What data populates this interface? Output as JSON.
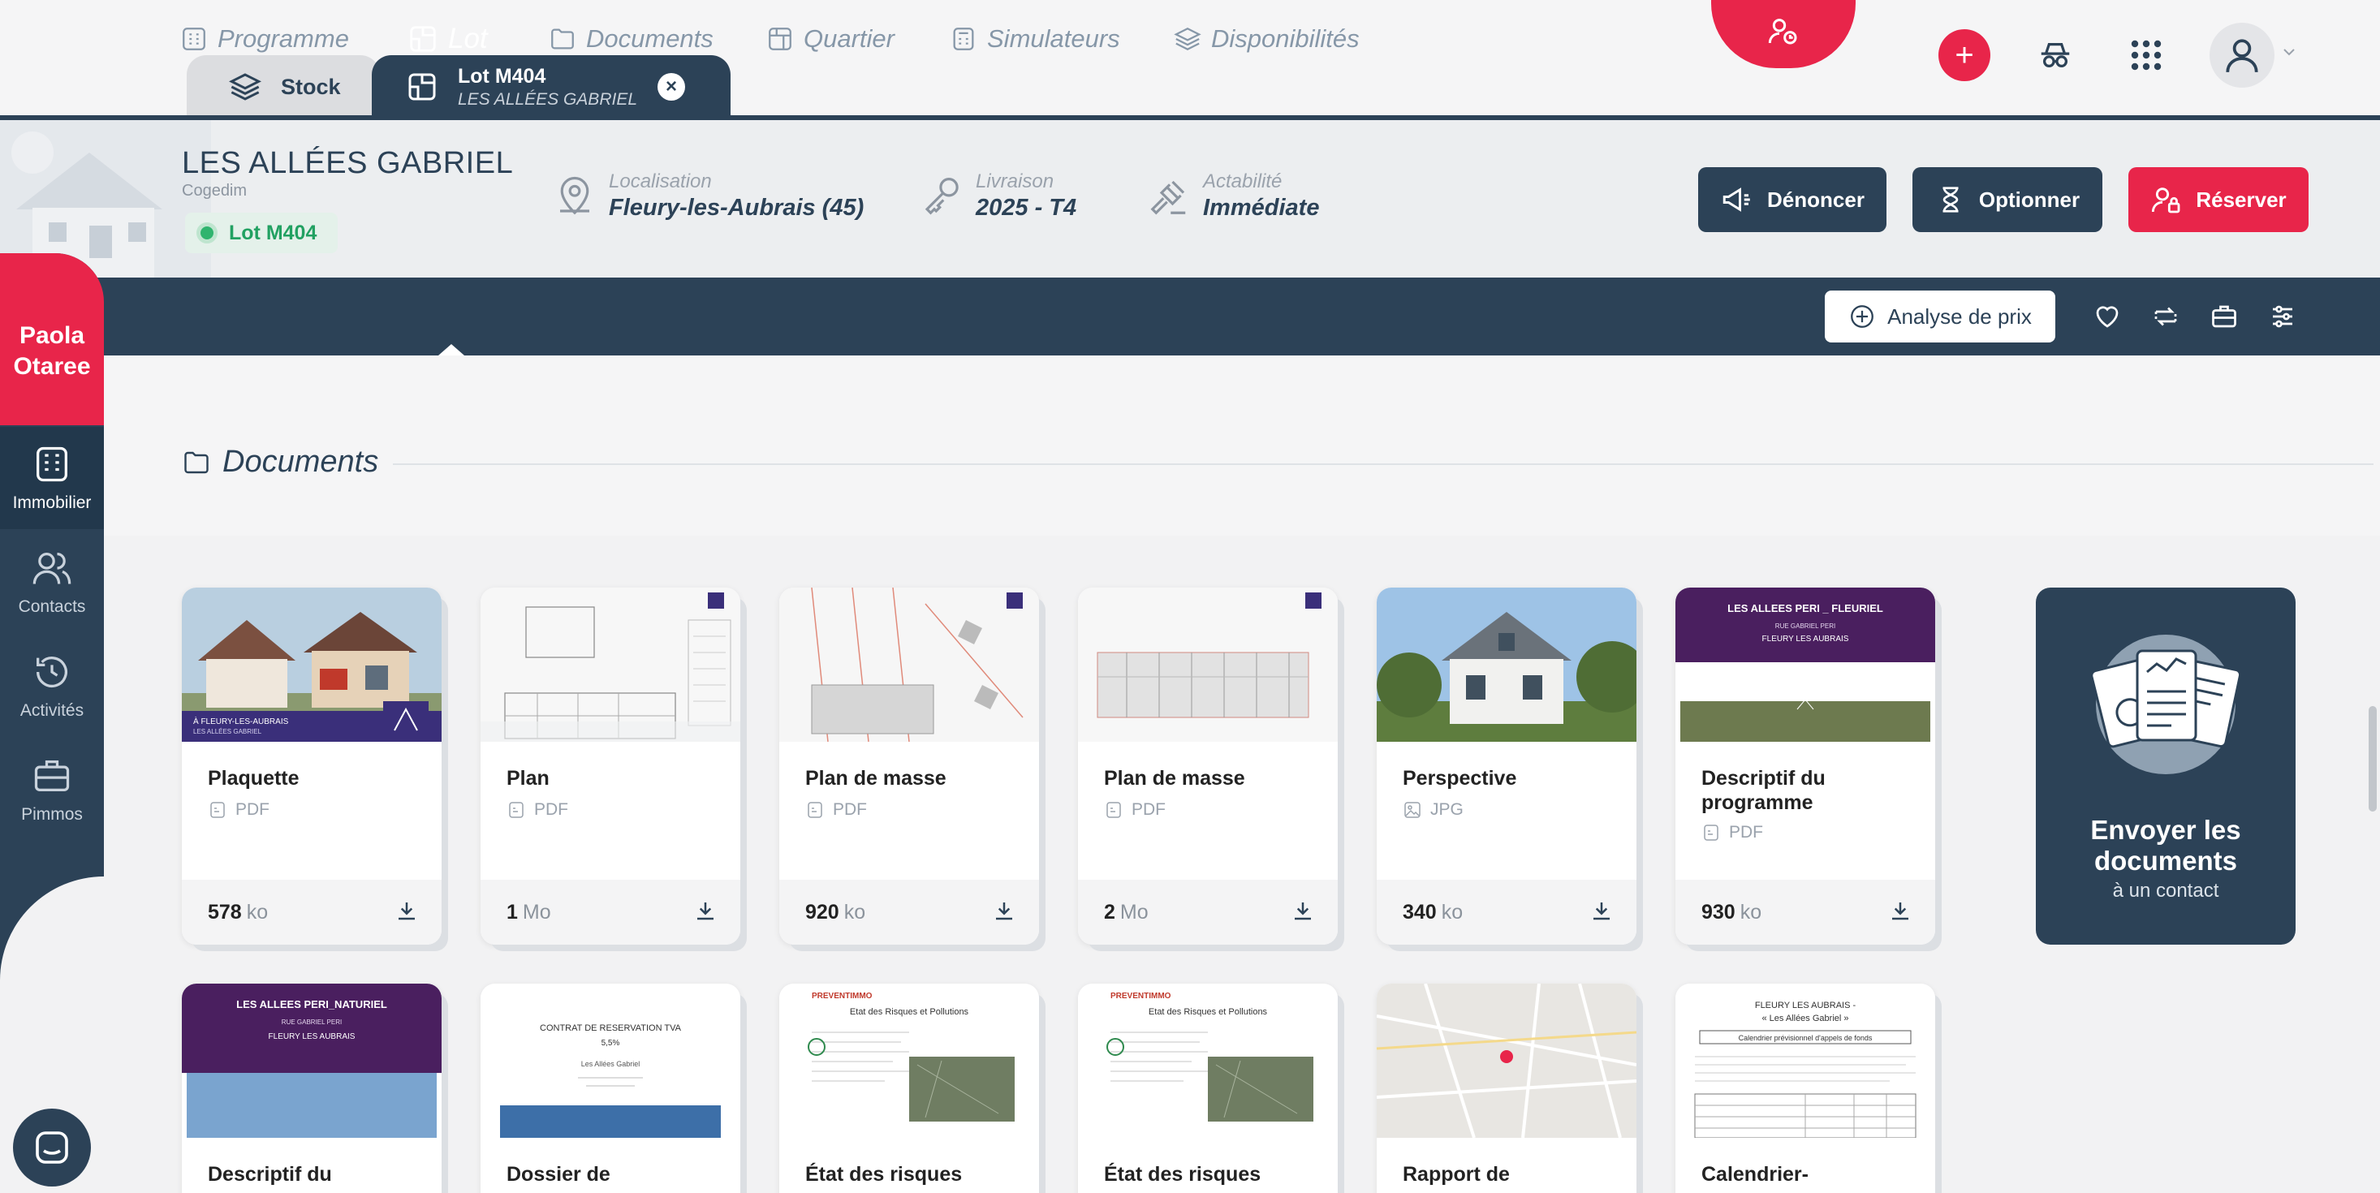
{
  "tabs": {
    "stock": "Stock",
    "lot_title": "Lot M404",
    "lot_subtitle": "LES ALLÉES GABRIEL"
  },
  "header": {
    "program_name": "LES ALLÉES GABRIEL",
    "developer": "Cogedim",
    "lot_badge": "Lot M404",
    "localisation_label": "Localisation",
    "localisation_value": "Fleury-les-Aubrais (45)",
    "livraison_label": "Livraison",
    "livraison_value": "2025 - T4",
    "actabilite_label": "Actabilité",
    "actabilite_value": "Immédiate",
    "btn_denoncer": "Dénoncer",
    "btn_optionner": "Optionner",
    "btn_reserver": "Réserver"
  },
  "nav": {
    "programme": "Programme",
    "lot": "Lot",
    "documents": "Documents",
    "quartier": "Quartier",
    "simulateurs": "Simulateurs",
    "disponibilites": "Disponibilités",
    "analyse_prix": "Analyse de prix"
  },
  "sidebar": {
    "user_first": "Paola",
    "user_last": "Otaree",
    "items": [
      "Immobilier",
      "Contacts",
      "Activités",
      "Pimmos"
    ]
  },
  "section": {
    "title": "Documents"
  },
  "documents_row1": [
    {
      "name": "Plaquette",
      "type": "PDF",
      "size": "578",
      "unit": "ko"
    },
    {
      "name": "Plan",
      "type": "PDF",
      "size": "1",
      "unit": "Mo"
    },
    {
      "name": "Plan de masse",
      "type": "PDF",
      "size": "920",
      "unit": "ko"
    },
    {
      "name": "Plan de masse",
      "type": "PDF",
      "size": "2",
      "unit": "Mo"
    },
    {
      "name": "Perspective",
      "type": "JPG",
      "size": "340",
      "unit": "ko"
    },
    {
      "name": "Descriptif du programme",
      "type": "PDF",
      "size": "930",
      "unit": "ko"
    }
  ],
  "documents_row2": [
    {
      "name": "Descriptif du"
    },
    {
      "name": "Dossier de"
    },
    {
      "name": "État des risques"
    },
    {
      "name": "État des risques"
    },
    {
      "name": "Rapport de"
    },
    {
      "name": "Calendrier-"
    }
  ],
  "thumb_text": {
    "plaquette_line1": "À FLEURY-LES-AUBRAIS",
    "plaquette_line2": "LES ALLÉES GABRIEL",
    "descriptif1_line1": "LES ALLEES PERI _ FLEURIEL",
    "descriptif1_line2": "RUE GABRIEL PERI",
    "descriptif1_line3": "FLEURY LES AUBRAIS",
    "descriptif2_line1": "LES ALLEES PERI_NATURIEL",
    "descriptif2_line2": "RUE GABRIEL PERI",
    "descriptif2_line3": "FLEURY LES AUBRAIS",
    "contrat_line1": "CONTRAT DE RESERVATION TVA",
    "contrat_line2": "5,5%",
    "contrat_line3": "Les Allées Gabriel",
    "risques_brand": "PREVENTIMMO",
    "risques_title": "Etat des Risques et Pollutions",
    "calendrier_line1": "FLEURY LES AUBRAIS -",
    "calendrier_line2": "« Les Allées Gabriel »",
    "calendrier_line3": "Calendrier prévisionnel d'appels de fonds"
  },
  "send_card": {
    "title": "Envoyer les documents",
    "subtitle": "à un contact"
  },
  "colors": {
    "navy": "#2c4257",
    "red": "#e8254a",
    "green": "#2fb46e"
  }
}
